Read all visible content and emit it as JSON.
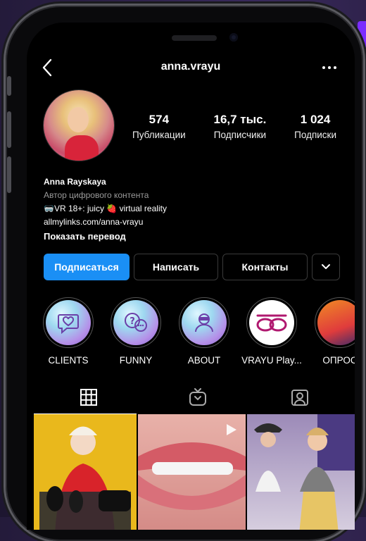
{
  "header": {
    "username": "anna.vrayu"
  },
  "profile": {
    "stats": [
      {
        "value": "574",
        "label": "Публикации"
      },
      {
        "value": "16,7 тыс.",
        "label": "Подписчики"
      },
      {
        "value": "1 024",
        "label": "Подписки"
      }
    ],
    "name": "Anna Rayskaya",
    "category": "Автор цифрового контента",
    "bio_line": "🥽VR 18+: juicy 🍓 virtual reality",
    "link": "allmylinks.com/anna-vrayu",
    "translate": "Показать перевод"
  },
  "actions": {
    "follow": "Подписаться",
    "message": "Написать",
    "contacts": "Контакты"
  },
  "highlights": [
    {
      "label": "CLIENTS",
      "icon": "heart-chat-icon"
    },
    {
      "label": "FUNNY",
      "icon": "question-chat-icon"
    },
    {
      "label": "ABOUT",
      "icon": "person-vr-icon"
    },
    {
      "label": "VRAYU Play...",
      "icon": "vrayu-logo-icon"
    },
    {
      "label": "ОПРОС",
      "icon": "photo"
    }
  ],
  "colors": {
    "primary_button": "#1a8ff5",
    "background": "#000000"
  }
}
